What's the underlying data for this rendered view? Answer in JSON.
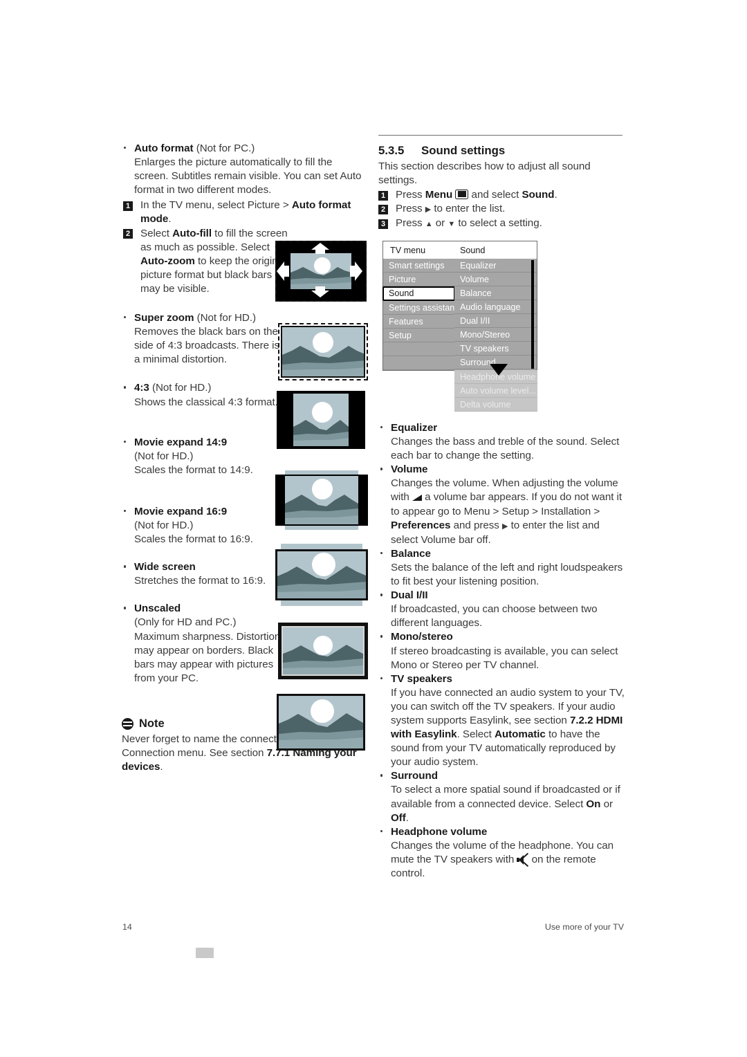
{
  "page": {
    "number": "14",
    "footer_title": "Use more of your TV"
  },
  "left_column": {
    "formats": [
      {
        "title": "Auto format",
        "qualifier": "(Not for PC.)",
        "desc": "Enlarges the picture automatically to fill the screen. Subtitles remain visible. You can set Auto format in two different modes.",
        "steps": [
          {
            "num": "1",
            "text_a": "In the TV menu, select Picture > ",
            "bold_a": "Auto format mode",
            "text_b": "."
          },
          {
            "num": "2",
            "text_a": "Select ",
            "bold_a": "Auto-fill",
            "text_b": " to fill the screen as much as possible. Select ",
            "bold_b": "Auto-zoom",
            "text_c": " to keep the original picture format but black bars may be visible."
          }
        ],
        "illustration": "auto-format-arrows"
      },
      {
        "title": "Super zoom",
        "qualifier": "(Not for HD.)",
        "desc": "Removes the black bars on the side of 4:3 broadcasts. There is a minimal distortion.",
        "illustration": "super-zoom"
      },
      {
        "title": "4:3",
        "qualifier": "(Not for HD.)",
        "desc": "Shows the classical 4:3 format.",
        "illustration": "four-three"
      },
      {
        "title": "Movie expand 14:9",
        "qualifier": "(Not for HD.)",
        "desc": "Scales the format to 14:9.",
        "illustration": "movie-expand-14-9"
      },
      {
        "title": "Movie expand 16:9",
        "qualifier": "(Not for HD.)",
        "desc": "Scales the format to 16:9.",
        "illustration": "movie-expand-16-9"
      },
      {
        "title": "Wide screen",
        "qualifier": "",
        "desc": "Stretches the format to 16:9.",
        "illustration": "wide-screen"
      },
      {
        "title": "Unscaled",
        "qualifier": "",
        "desc": "(Only for HD and PC.) Maximum sharpness. Distortion may appear on borders. Black bars may appear with pictures from your PC.",
        "illustration": "unscaled"
      }
    ],
    "note": {
      "heading": "Note",
      "text_a": "Never forget to name the connection in the Connection menu. See section ",
      "bold_a": "7.7.1 Naming your devices",
      "text_b": "."
    }
  },
  "right_column": {
    "section": {
      "number": "5.3.5",
      "title": "Sound settings",
      "intro": "This section describes how to adjust all sound settings.",
      "steps": [
        {
          "num": "1",
          "text_a": "Press ",
          "bold_a": "Menu",
          "icon": "menu-glyph",
          "text_b": " and select ",
          "bold_b": "Sound",
          "text_c": "."
        },
        {
          "num": "2",
          "text_a": "Press ",
          "arrow": "▶",
          "text_b": " to enter the list."
        },
        {
          "num": "3",
          "text_a": "Press ",
          "arrow_up": "▲",
          "text_b": " or ",
          "arrow_down": "▼",
          "text_c": " to select a setting."
        }
      ]
    },
    "tv_menu": {
      "header_left": "TV menu",
      "header_right": "Sound",
      "left_items": [
        "Smart settings",
        "Picture",
        "Sound",
        "Settings assistant",
        "Features",
        "Setup"
      ],
      "selected_left": "Sound",
      "right_items": [
        "Equalizer",
        "Volume",
        "Balance",
        "Audio language",
        "Dual I/II",
        "Mono/Stereo",
        "TV speakers",
        "Surround"
      ],
      "overflow_items": [
        "Headphone volume",
        "Auto volume level...",
        "Delta volume"
      ]
    },
    "settings": [
      {
        "title": "Equalizer",
        "parts": [
          {
            "t": "Changes the bass and treble of the sound. Select each bar to change the setting."
          }
        ]
      },
      {
        "title": "Volume",
        "parts": [
          {
            "t": "Changes the volume. When adjusting the volume with "
          },
          {
            "icon": "volume-glyph"
          },
          {
            "t": " a volume bar appears. If you do not want it to appear go to Menu > Setup > Installation > "
          },
          {
            "t": "Preferences",
            "b": true
          },
          {
            "t": " and press "
          },
          {
            "t": "▶"
          },
          {
            "t": " to enter the list and select Volume bar off."
          }
        ]
      },
      {
        "title": "Balance",
        "parts": [
          {
            "t": "Sets the balance of the left and right loudspeakers to fit best your listening position."
          }
        ]
      },
      {
        "title": "Dual I/II",
        "parts": [
          {
            "t": "If broadcasted, you can choose between two different languages."
          }
        ]
      },
      {
        "title": "Mono/stereo",
        "parts": [
          {
            "t": "If stereo broadcasting is available, you can select Mono or Stereo per TV channel."
          }
        ]
      },
      {
        "title": "TV speakers",
        "parts": [
          {
            "t": "If you have connected an audio system to your TV, you can switch off the TV speakers. If your audio system supports Easylink, see section "
          },
          {
            "t": "7.2.2 HDMI with Easylink",
            "b": true
          },
          {
            "t": ". Select "
          },
          {
            "t": "Automatic",
            "b": true
          },
          {
            "t": " to have the sound from your TV automatically reproduced by your audio system."
          }
        ]
      },
      {
        "title": "Surround",
        "parts": [
          {
            "t": "To select a more spatial sound if broadcasted or if available from a connected device. Select "
          },
          {
            "t": "On",
            "b": true
          },
          {
            "t": " or "
          },
          {
            "t": "Off",
            "b": true
          },
          {
            "t": "."
          }
        ]
      },
      {
        "title": "Headphone volume",
        "parts": [
          {
            "t": "Changes the volume of the headphone. You can mute the TV speakers with "
          },
          {
            "icon": "mute-glyph"
          },
          {
            "t": " on the remote control."
          }
        ]
      }
    ]
  },
  "colors": {
    "sky": "#b3c5cc",
    "mountain_dark": "#4c6367",
    "mountain_mid": "#8aa3a9",
    "sun": "#ffffff",
    "menu_gray": "#a6a6a6",
    "menu_gray_dim": "#c6c6c6",
    "text": "#3b3b3d"
  }
}
